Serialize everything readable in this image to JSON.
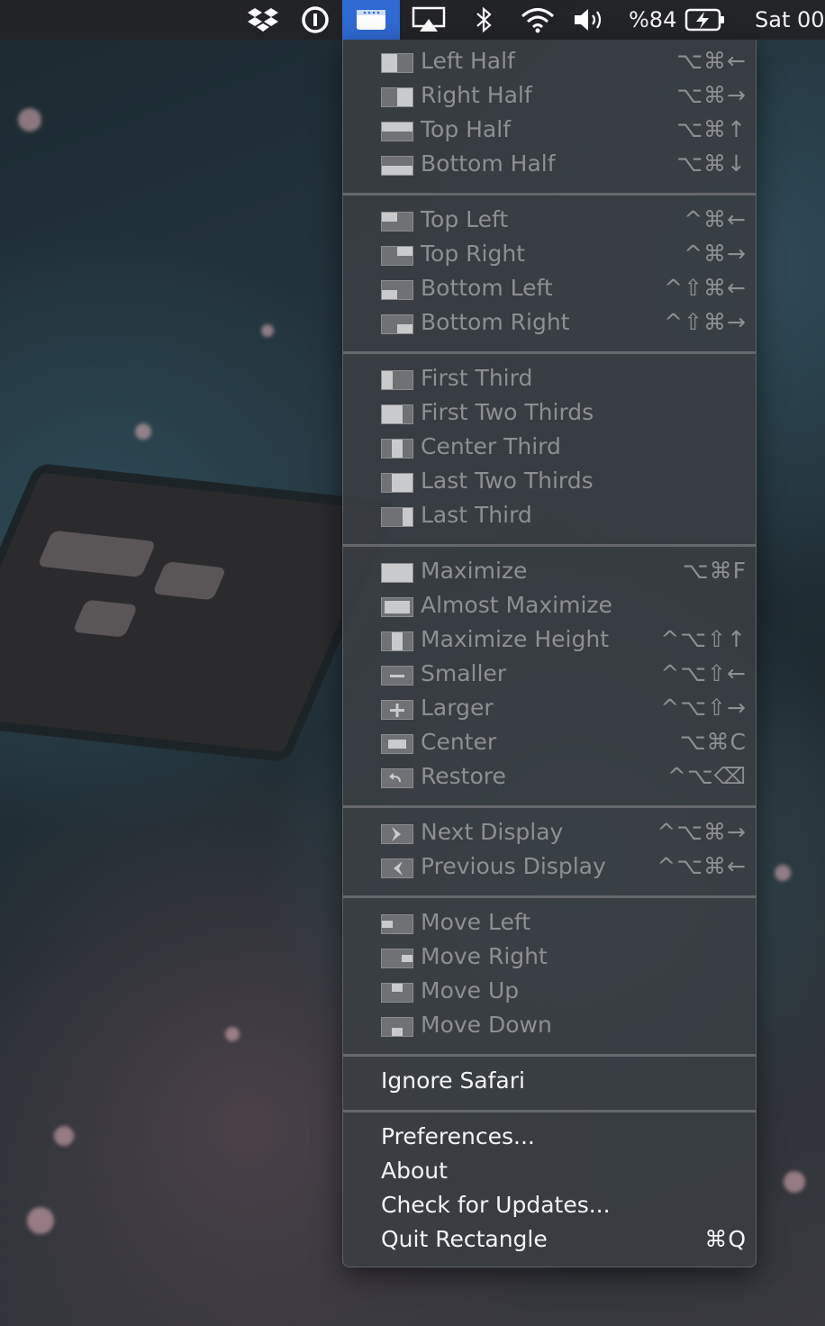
{
  "menubar": {
    "icons": [
      "dropbox-icon",
      "onepassword-icon",
      "rectangle-icon",
      "airplay-icon",
      "bluetooth-icon",
      "wifi-icon",
      "volume-icon"
    ],
    "battery_text": "%84",
    "clock_text": "Sat 00"
  },
  "menu": {
    "window_halves": [
      {
        "label": "Left Half",
        "shortcut": "⌥⌘←",
        "icon": "left-half-icon"
      },
      {
        "label": "Right Half",
        "shortcut": "⌥⌘→",
        "icon": "right-half-icon"
      },
      {
        "label": "Top Half",
        "shortcut": "⌥⌘↑",
        "icon": "top-half-icon"
      },
      {
        "label": "Bottom Half",
        "shortcut": "⌥⌘↓",
        "icon": "bottom-half-icon"
      }
    ],
    "corners": [
      {
        "label": "Top Left",
        "shortcut": "^⌘←",
        "icon": "top-left-icon"
      },
      {
        "label": "Top Right",
        "shortcut": "^⌘→",
        "icon": "top-right-icon"
      },
      {
        "label": "Bottom Left",
        "shortcut": "^⇧⌘←",
        "icon": "bottom-left-icon"
      },
      {
        "label": "Bottom Right",
        "shortcut": "^⇧⌘→",
        "icon": "bottom-right-icon"
      }
    ],
    "thirds": [
      {
        "label": "First Third",
        "shortcut": "",
        "icon": "first-third-icon"
      },
      {
        "label": "First Two Thirds",
        "shortcut": "",
        "icon": "first-two-thirds-icon"
      },
      {
        "label": "Center Third",
        "shortcut": "",
        "icon": "center-third-icon"
      },
      {
        "label": "Last Two Thirds",
        "shortcut": "",
        "icon": "last-two-thirds-icon"
      },
      {
        "label": "Last Third",
        "shortcut": "",
        "icon": "last-third-icon"
      }
    ],
    "sizing": [
      {
        "label": "Maximize",
        "shortcut": "⌥⌘F",
        "icon": "maximize-icon"
      },
      {
        "label": "Almost Maximize",
        "shortcut": "",
        "icon": "almost-maximize-icon"
      },
      {
        "label": "Maximize Height",
        "shortcut": "^⌥⇧↑",
        "icon": "maximize-height-icon"
      },
      {
        "label": "Smaller",
        "shortcut": "^⌥⇧←",
        "icon": "smaller-icon"
      },
      {
        "label": "Larger",
        "shortcut": "^⌥⇧→",
        "icon": "larger-icon"
      },
      {
        "label": "Center",
        "shortcut": "⌥⌘C",
        "icon": "center-icon"
      },
      {
        "label": "Restore",
        "shortcut": "^⌥⌫",
        "icon": "restore-icon"
      }
    ],
    "displays": [
      {
        "label": "Next Display",
        "shortcut": "^⌥⌘→",
        "icon": "next-display-icon"
      },
      {
        "label": "Previous Display",
        "shortcut": "^⌥⌘←",
        "icon": "previous-display-icon"
      }
    ],
    "moves": [
      {
        "label": "Move Left",
        "shortcut": "",
        "icon": "move-left-icon"
      },
      {
        "label": "Move Right",
        "shortcut": "",
        "icon": "move-right-icon"
      },
      {
        "label": "Move Up",
        "shortcut": "",
        "icon": "move-up-icon"
      },
      {
        "label": "Move Down",
        "shortcut": "",
        "icon": "move-down-icon"
      }
    ],
    "ignore": {
      "label": "Ignore Safari"
    },
    "app": [
      {
        "label": "Preferences...",
        "shortcut": ""
      },
      {
        "label": "About",
        "shortcut": ""
      },
      {
        "label": "Check for Updates...",
        "shortcut": ""
      },
      {
        "label": "Quit Rectangle",
        "shortcut": "⌘Q"
      }
    ]
  },
  "colors": {
    "menubar_active": "#2f6ad3",
    "menu_bg": "#3a3e42",
    "disabled_text": "#8e8f91",
    "enabled_text": "#f4f4f4"
  }
}
